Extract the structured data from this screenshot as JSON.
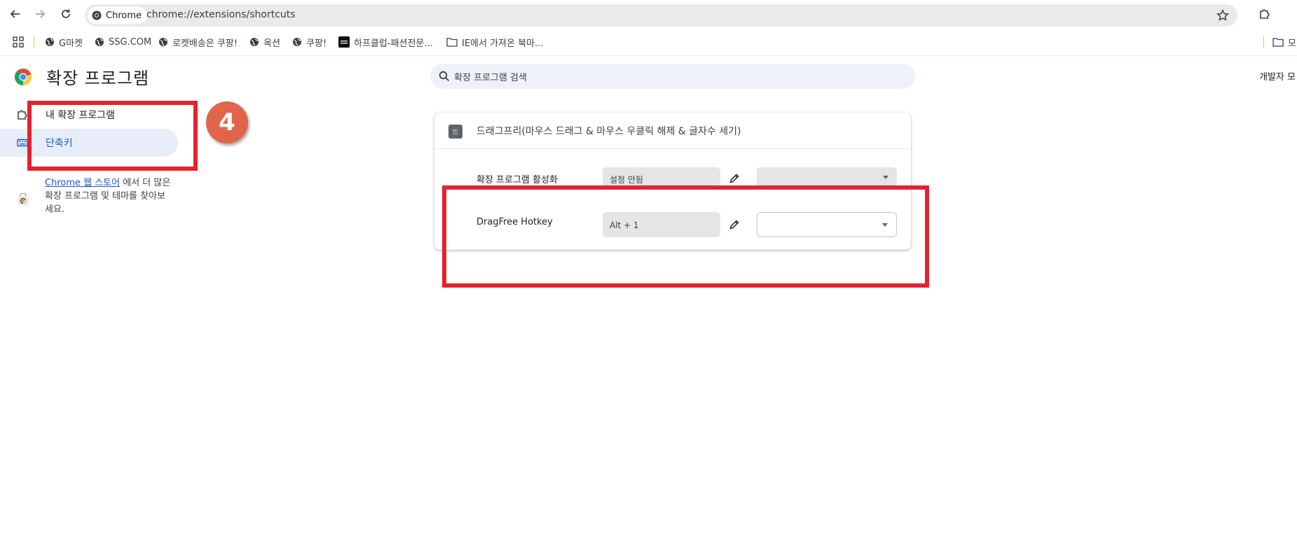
{
  "toolbar": {
    "chip_label": "Chrome",
    "url": "chrome://extensions/shortcuts"
  },
  "bookmarks": [
    {
      "label": "G마켓",
      "icon": "globe-icon"
    },
    {
      "label": "SSG.COM",
      "icon": "globe-icon"
    },
    {
      "label": "로켓배송은 쿠팡!",
      "icon": "globe-icon"
    },
    {
      "label": "옥션",
      "icon": "globe-icon"
    },
    {
      "label": "쿠팡!",
      "icon": "globe-icon"
    },
    {
      "label": "하프클럽-패션전문...",
      "icon": "halfclub-logo"
    },
    {
      "label": "IE에서 가져온 북마...",
      "icon": "folder-icon"
    },
    {
      "label": "모",
      "icon": "folder-icon"
    }
  ],
  "header": {
    "title": "확장 프로그램",
    "search_placeholder": "확장 프로그램 검색",
    "dev_mode_label": "개발자 모"
  },
  "sidebar": {
    "items": [
      {
        "label": "내 확장 프로그램",
        "icon": "puzzle-icon"
      },
      {
        "label": "단축키",
        "icon": "keyboard-icon",
        "active": true
      }
    ],
    "store_link": "Chrome 웹 스토어",
    "store_text": "에서 더 많은 확장 프로그램 및 테마를 찾아보세요."
  },
  "annotation": {
    "step_number": "4",
    "color": "#e4222d"
  },
  "extension": {
    "icon_letter": "드",
    "name": "드래그프리(마우스 드래그 & 마우스 우클릭 해제 & 글자수 세기)",
    "rows": [
      {
        "label": "확장 프로그램 활성화",
        "shortcut": "설정 안됨",
        "scope": ""
      },
      {
        "label": "DragFree Hotkey",
        "shortcut": "Alt + 1",
        "scope": ""
      }
    ]
  },
  "colors": {
    "accent": "#1a57c7",
    "active_bg": "#e7eef9",
    "badge": "#e0654a"
  }
}
